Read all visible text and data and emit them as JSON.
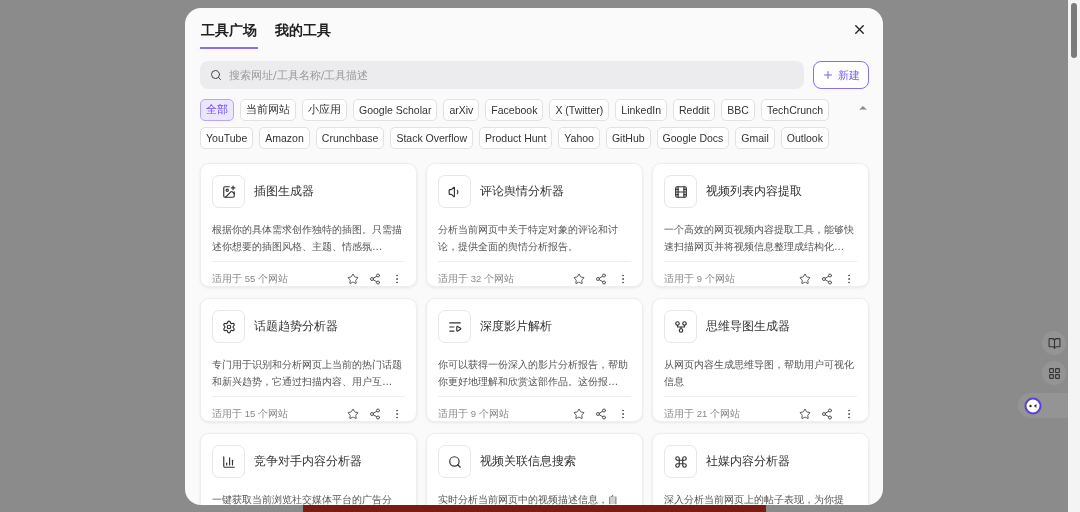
{
  "tabs": [
    {
      "label": "工具广场",
      "selected": true
    },
    {
      "label": "我的工具",
      "selected": false
    }
  ],
  "search": {
    "placeholder": "搜索网址/工具名称/工具描述"
  },
  "new_button": "新建",
  "filters": [
    {
      "label": "全部",
      "selected": true
    },
    {
      "label": "当前网站",
      "selected": false
    },
    {
      "label": "小应用",
      "selected": false
    },
    {
      "label": "Google Scholar",
      "selected": false
    },
    {
      "label": "arXiv",
      "selected": false
    },
    {
      "label": "Facebook",
      "selected": false
    },
    {
      "label": "X (Twitter)",
      "selected": false
    },
    {
      "label": "LinkedIn",
      "selected": false
    },
    {
      "label": "Reddit",
      "selected": false
    },
    {
      "label": "BBC",
      "selected": false
    },
    {
      "label": "TechCrunch",
      "selected": false
    },
    {
      "label": "YouTube",
      "selected": false
    },
    {
      "label": "Amazon",
      "selected": false
    },
    {
      "label": "Crunchbase",
      "selected": false
    },
    {
      "label": "Stack Overflow",
      "selected": false
    },
    {
      "label": "Product Hunt",
      "selected": false
    },
    {
      "label": "Yahoo",
      "selected": false
    },
    {
      "label": "GitHub",
      "selected": false
    },
    {
      "label": "Google Docs",
      "selected": false
    },
    {
      "label": "Gmail",
      "selected": false
    },
    {
      "label": "Outlook",
      "selected": false
    }
  ],
  "tools": [
    {
      "title": "插图生成器",
      "description": "根据你的具体需求创作独特的插图。只需描述你想要的插图风格、主题、情感氛…",
      "sites": "适用于 55 个网站"
    },
    {
      "title": "评论舆情分析器",
      "description": "分析当前网页中关于特定对象的评论和讨论，提供全面的舆情分析报告。",
      "sites": "适用于 32 个网站"
    },
    {
      "title": "视频列表内容提取",
      "description": "一个高效的网页视频内容提取工具，能够快速扫描网页并将视频信息整理成结构化…",
      "sites": "适用于 9 个网站"
    },
    {
      "title": "话题趋势分析器",
      "description": "专门用于识别和分析网页上当前的热门话题和新兴趋势，它通过扫描内容、用户互…",
      "sites": "适用于 15 个网站"
    },
    {
      "title": "深度影片解析",
      "description": "你可以获得一份深入的影片分析报告，帮助你更好地理解和欣赏这部作品。这份报…",
      "sites": "适用于 9 个网站"
    },
    {
      "title": "思维导图生成器",
      "description": "从网页内容生成思维导图，帮助用户可视化信息",
      "sites": "适用于 21 个网站"
    },
    {
      "title": "竞争对手内容分析器",
      "description": "一键获取当前浏览社交媒体平台的广告分"
    },
    {
      "title": "视频关联信息搜索",
      "description": "实时分析当前网页中的视频描述信息，自"
    },
    {
      "title": "社媒内容分析器",
      "description": "深入分析当前网页上的帖子表现，为你提"
    }
  ]
}
